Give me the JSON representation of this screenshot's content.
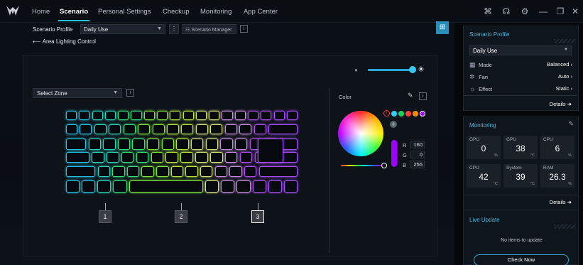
{
  "nav": {
    "tabs": [
      {
        "label": "Home"
      },
      {
        "label": "Scenario"
      },
      {
        "label": "Personal Settings"
      },
      {
        "label": "Checkup"
      },
      {
        "label": "Monitoring"
      },
      {
        "label": "App Center"
      }
    ],
    "active_tab": "Scenario",
    "icons": [
      "gamepad-icon",
      "headset-icon",
      "settings-icon",
      "minimize-icon",
      "restore-icon",
      "close-icon"
    ],
    "icon_glyphs": [
      "⌘",
      "☊",
      "⚙",
      "—",
      "❐",
      "✕"
    ]
  },
  "scenario": {
    "profile_label": "Scenario Profile",
    "profile_value": "Daily Use",
    "manager_label": "Scenario Manager",
    "back_label": "Area Lighting Control"
  },
  "lighting": {
    "zone_placeholder": "Select Zone",
    "zones": [
      "1",
      "2",
      "3"
    ],
    "colors": {
      "accent": "#22c3e6"
    }
  },
  "color_panel": {
    "title": "Color",
    "swatches": [
      "#2ad1ff",
      "#19d45a",
      "#ff3b3b",
      "#ff8a00",
      "#a000ff"
    ],
    "r_label": "R",
    "r_value": "160",
    "g_label": "G",
    "g_value": "0",
    "b_label": "B",
    "b_value": "255"
  },
  "side": {
    "profile_card": {
      "title": "Scenario Profile",
      "selected": "Daily Use",
      "rows": [
        {
          "label": "Mode",
          "value": "Balanced"
        },
        {
          "label": "Fan",
          "value": "Auto"
        },
        {
          "label": "Effect",
          "value": "Static"
        }
      ],
      "details": "Details"
    },
    "monitoring_card": {
      "title": "Monitoring",
      "cells": [
        {
          "label": "GPU",
          "value": "0",
          "unit": "%"
        },
        {
          "label": "GPU",
          "value": "38",
          "unit": "°C"
        },
        {
          "label": "CPU",
          "value": "6",
          "unit": "%"
        },
        {
          "label": "CPU",
          "value": "42",
          "unit": "°C"
        },
        {
          "label": "System",
          "value": "39",
          "unit": "°C"
        },
        {
          "label": "RAM",
          "value": "26.3",
          "unit": "%"
        }
      ],
      "details": "Details"
    },
    "live_update_card": {
      "title": "Live Update",
      "empty_text": "No items to update",
      "button": "Check Now"
    }
  }
}
